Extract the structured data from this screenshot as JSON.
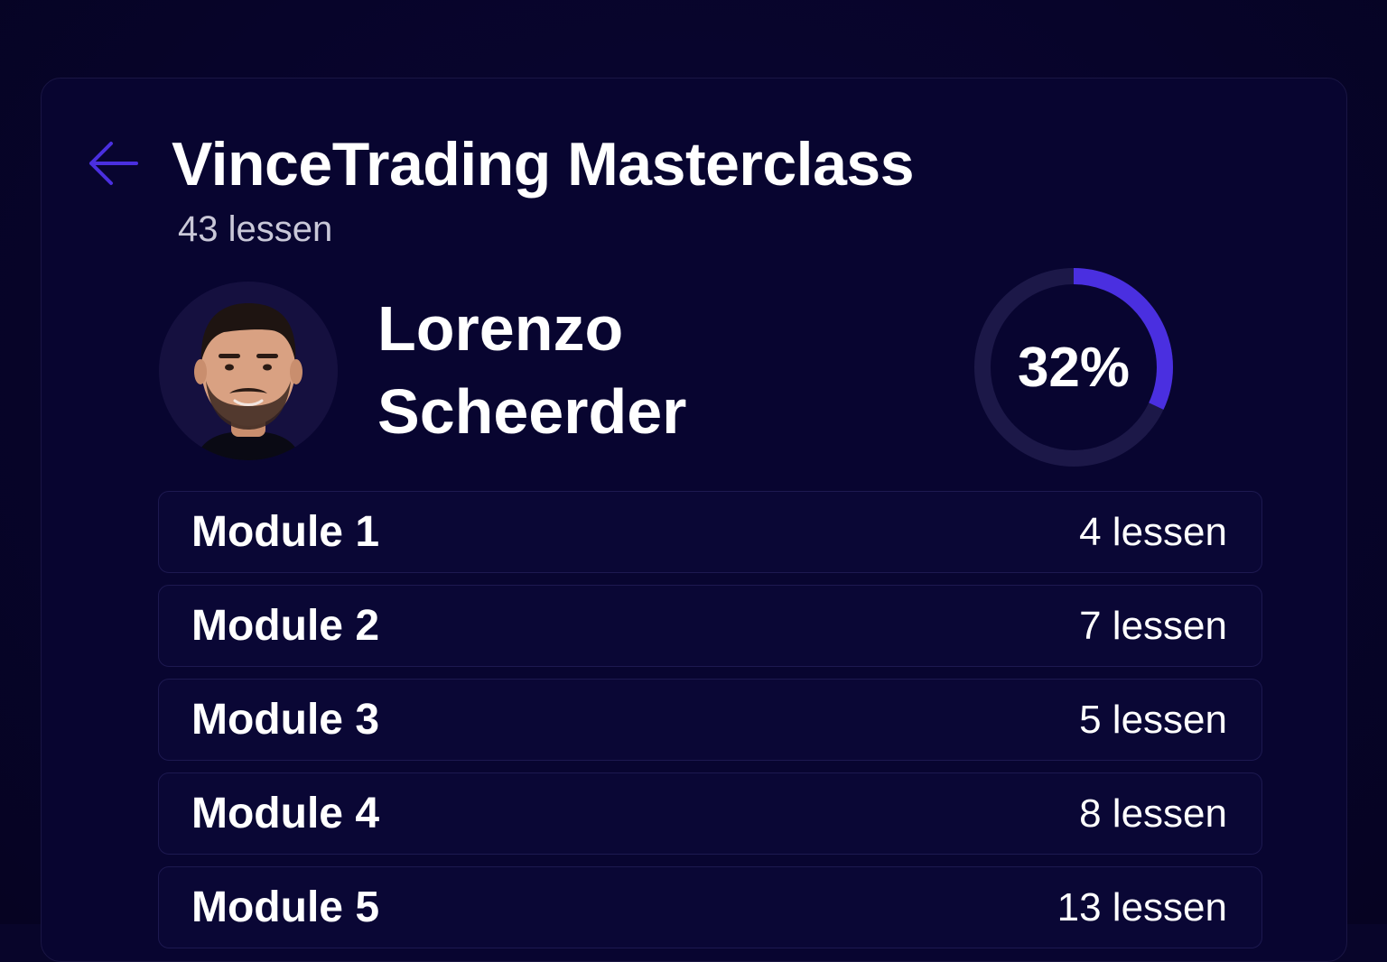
{
  "course": {
    "title": "VinceTrading Masterclass",
    "lesson_count": "43 lessen"
  },
  "instructor": {
    "first_name": "Lorenzo",
    "last_name": "Scheerder",
    "avatar_icon": "person-portrait"
  },
  "progress": {
    "label": "32%",
    "fraction": 0.32
  },
  "modules": [
    {
      "name": "Module 1",
      "lessons": "4 lessen"
    },
    {
      "name": "Module 2",
      "lessons": "7 lessen"
    },
    {
      "name": "Module 3",
      "lessons": "5 lessen"
    },
    {
      "name": "Module 4",
      "lessons": "8 lessen"
    },
    {
      "name": "Module 5",
      "lessons": "13 lessen"
    }
  ],
  "colors": {
    "background": "#08052a",
    "accent": "#4a2fe0",
    "track": "#1c1848"
  }
}
